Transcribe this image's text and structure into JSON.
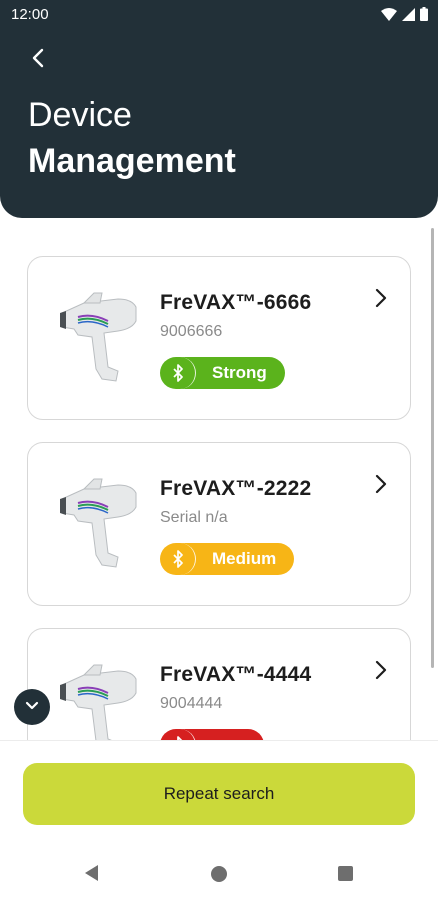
{
  "status_bar": {
    "time": "12:00"
  },
  "header": {
    "title_line1": "Device",
    "title_line2": "Management"
  },
  "devices": [
    {
      "name": "FreVAX™-6666",
      "serial": "9006666",
      "signal": "Strong",
      "signal_color": "#5bb31c"
    },
    {
      "name": "FreVAX™-2222",
      "serial": "Serial n/a",
      "signal": "Medium",
      "signal_color": "#f7b516"
    },
    {
      "name": "FreVAX™-4444",
      "serial": "9004444",
      "signal": "",
      "signal_color": "#d62020"
    }
  ],
  "actions": {
    "repeat_search_label": "Repeat search"
  },
  "colors": {
    "header_bg": "#223038",
    "button_bg": "#cbd93a",
    "accent_strong": "#5bb31c",
    "accent_medium": "#f7b516",
    "accent_weak": "#d62020"
  },
  "icons": [
    "back-arrow-icon",
    "wifi-icon",
    "cellular-icon",
    "battery-icon",
    "bluetooth-icon",
    "chevron-right-icon",
    "chevron-down-icon",
    "nav-back-icon",
    "nav-home-icon",
    "nav-recent-icon"
  ]
}
